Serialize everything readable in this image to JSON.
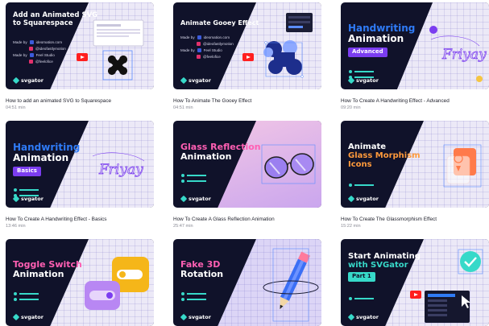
{
  "brand": "svgator",
  "cards": [
    {
      "thumb_title": [
        "Add an Animated SVG",
        "to Squarespace"
      ],
      "credits": [
        {
          "label": "Made by",
          "value": "ideomation.com"
        },
        {
          "label": "",
          "value": "@ideofastlymotion"
        },
        {
          "label": "Made by",
          "value": "Feel Studio"
        },
        {
          "label": "",
          "value": "@feelofice"
        }
      ],
      "title": "How to add an animated SVG to Squarespace",
      "duration": "04:51 min"
    },
    {
      "thumb_title": [
        "Animate Gooey Effect"
      ],
      "credits": [
        {
          "label": "Made by",
          "value": "ideomation.com"
        },
        {
          "label": "",
          "value": "@ideofastlymotion"
        },
        {
          "label": "Made by",
          "value": "Feel Studio"
        },
        {
          "label": "",
          "value": "@feelofice"
        }
      ],
      "title": "How To Animate The Gooey Effect",
      "duration": "04:51 min"
    },
    {
      "thumb_title": [
        "Handwriting",
        "Animation"
      ],
      "badge": "Advanced",
      "script": "Friyay",
      "title": "How To Create A Handwriting Effect - Advanced",
      "duration": "09:20 min"
    },
    {
      "thumb_title": [
        "Handwriting",
        "Animation"
      ],
      "badge": "Basics",
      "script": "Friyay",
      "title": "How To Create A Handwriting Effect - Basics",
      "duration": "13:46 min"
    },
    {
      "thumb_title": [
        "Glass Reflection",
        "Animation"
      ],
      "title": "How To Create A Glass Reflection Animation",
      "duration": "25:47 min"
    },
    {
      "thumb_title": [
        "Animate",
        "Glass Morphism",
        "Icons"
      ],
      "title": "How To Create The Glassmorphism Effect",
      "duration": "15:22 min"
    },
    {
      "thumb_title": [
        "Toggle Switch",
        "Animation"
      ],
      "title": "",
      "duration": ""
    },
    {
      "thumb_title": [
        "Fake 3D",
        "Rotation"
      ],
      "title": "",
      "duration": ""
    },
    {
      "thumb_title": [
        "Start Animating",
        "with SVGator"
      ],
      "badge": "Part 1",
      "title": "",
      "duration": ""
    }
  ],
  "colors": {
    "navy": "#10122a",
    "teal": "#37d9c9",
    "blue_title": "#2f7bf6",
    "pink_title": "#ff5fb3",
    "purple_badge": "#7b3df0",
    "orange_title": "#ff9a3b",
    "youtube": "#ff1f1f"
  }
}
